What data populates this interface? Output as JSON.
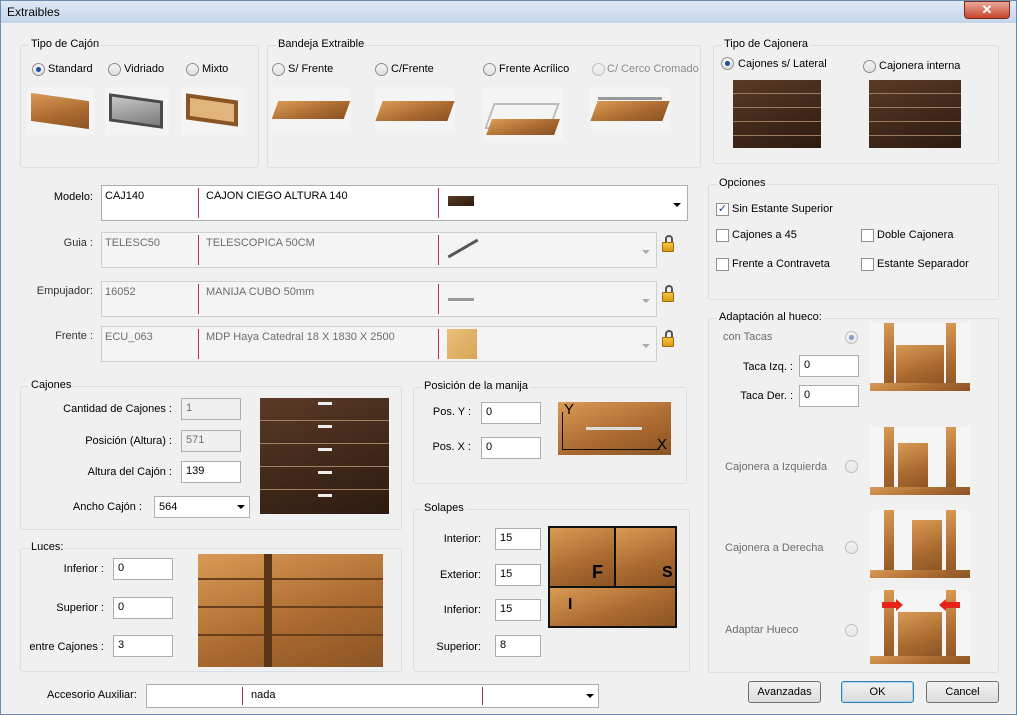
{
  "window": {
    "title": "Extraibles",
    "close_symbol": "✕"
  },
  "tipo_cajon": {
    "title": "Tipo de Cajón",
    "options": [
      {
        "label": "Standard",
        "selected": true
      },
      {
        "label": "Vidriado",
        "selected": false
      },
      {
        "label": "Mixto",
        "selected": false
      }
    ]
  },
  "bandeja": {
    "title": "Bandeja Extraible",
    "options": [
      {
        "label": "S/ Frente",
        "selected": false
      },
      {
        "label": "C/Frente",
        "selected": false
      },
      {
        "label": "Frente Acrílico",
        "selected": false
      },
      {
        "label": "C/ Cerco Cromado",
        "selected": false,
        "disabled": true
      }
    ]
  },
  "tipo_cajonera": {
    "title": "Tipo de Cajonera",
    "options": [
      {
        "label": "Cajones s/ Lateral",
        "selected": true
      },
      {
        "label": "Cajonera interna",
        "selected": false
      }
    ]
  },
  "modelo": {
    "label": "Modelo:",
    "code": "CAJ140",
    "desc": "CAJON CIEGO ALTURA 140"
  },
  "guia": {
    "label": "Guia :",
    "code": "TELESC50",
    "desc": "TELESCOPICA 50CM"
  },
  "empujador": {
    "label": "Empujador:",
    "code": "16052",
    "desc": "MANIJA CUBO 50mm"
  },
  "frente": {
    "label": "Frente :",
    "code": "ECU_063",
    "desc": "MDP Haya Catedral 18 X 1830 X 2500"
  },
  "opciones": {
    "title": "Opciones",
    "items": [
      {
        "label": "Sin Estante Superior",
        "checked": true
      },
      {
        "label": "Cajones a 45",
        "checked": false
      },
      {
        "label": "Doble Cajonera",
        "checked": false
      },
      {
        "label": "Frente a Contraveta",
        "checked": false
      },
      {
        "label": "Estante Separador",
        "checked": false
      }
    ]
  },
  "cajones": {
    "title": "Cajones",
    "cantidad_label": "Cantidad de Cajones :",
    "cantidad": "1",
    "posicion_label": "Posición (Altura) :",
    "posicion": "571",
    "altura_label": "Altura del Cajón :",
    "altura": "139",
    "ancho_label": "Ancho Cajón :",
    "ancho": "564"
  },
  "manija": {
    "title": "Posición de la manija",
    "posy_label": "Pos. Y :",
    "posy": "0",
    "posx_label": "Pos. X :",
    "posx": "0",
    "axis_y": "Y",
    "axis_x": "X"
  },
  "luces": {
    "title": "Luces:",
    "inferior_label": "Inferior :",
    "inferior": "0",
    "superior_label": "Superior :",
    "superior": "0",
    "entre_label": "entre Cajones :",
    "entre": "3"
  },
  "solapes": {
    "title": "Solapes",
    "interior_label": "Interior:",
    "interior": "15",
    "exterior_label": "Exterior:",
    "exterior": "15",
    "inferior_label": "Inferior:",
    "inferior": "15",
    "superior_label": "Superior:",
    "superior": "8",
    "img_f": "F",
    "img_s": "S",
    "img_i": "I"
  },
  "adaptacion": {
    "title": "Adaptación al hueco:",
    "con_tacas_label": "con Tacas",
    "con_tacas_selected": true,
    "taca_izq_label": "Taca Izq. :",
    "taca_izq": "0",
    "taca_der_label": "Taca Der. :",
    "taca_der": "0",
    "izquierda_label": "Cajonera a Izquierda",
    "derecha_label": "Cajonera a Derecha",
    "adaptar_label": "Adaptar Hueco"
  },
  "accesorio": {
    "label": "Accesorio Auxiliar:",
    "code": "",
    "value": "nada"
  },
  "buttons": {
    "avanzadas": "Avanzadas",
    "ok": "OK",
    "cancel": "Cancel"
  },
  "colors": {
    "accent_red": "#e8231a",
    "wood": "#b87a3d",
    "dark_wood": "#4a2f1e",
    "selected_radio": "#1e4f9c"
  }
}
